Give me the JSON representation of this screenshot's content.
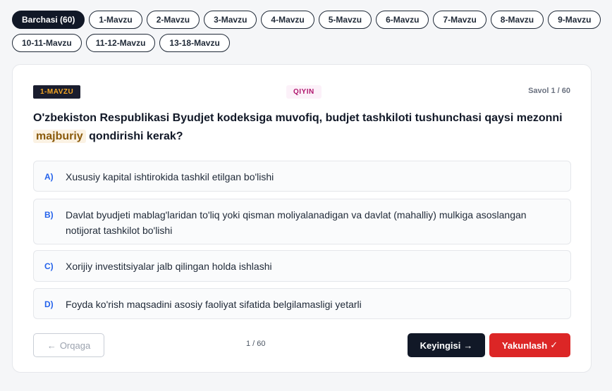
{
  "filters": {
    "chips": [
      {
        "label": "Barchasi (60)",
        "active": true
      },
      {
        "label": "1-Mavzu",
        "active": false
      },
      {
        "label": "2-Mavzu",
        "active": false
      },
      {
        "label": "3-Mavzu",
        "active": false
      },
      {
        "label": "4-Mavzu",
        "active": false
      },
      {
        "label": "5-Mavzu",
        "active": false
      },
      {
        "label": "6-Mavzu",
        "active": false
      },
      {
        "label": "7-Mavzu",
        "active": false
      },
      {
        "label": "8-Mavzu",
        "active": false
      },
      {
        "label": "9-Mavzu",
        "active": false
      },
      {
        "label": "10-11-Mavzu",
        "active": false
      },
      {
        "label": "11-12-Mavzu",
        "active": false
      },
      {
        "label": "13-18-Mavzu",
        "active": false
      }
    ]
  },
  "question_card": {
    "topic_badge": "1-MAVZU",
    "difficulty_badge": "QIYIN",
    "counter": "Savol 1 / 60",
    "question_before": "O'zbekiston Respublikasi Byudjet kodeksiga muvofiq, budjet tashkiloti tushunchasi qaysi mezonni",
    "question_highlight": "majburiy",
    "question_after": "qondirishi kerak?",
    "options": [
      {
        "letter": "A)",
        "text": "Xususiy kapital ishtirokida tashkil etilgan bo'lishi"
      },
      {
        "letter": "B)",
        "text": "Davlat byudjeti mablag'laridan to'liq yoki qisman moliyalanadigan va davlat (mahalliy) mulkiga asoslangan notijorat tashkilot bo'lishi"
      },
      {
        "letter": "C)",
        "text": "Xorijiy investitsiyalar jalb qilingan holda ishlashi"
      },
      {
        "letter": "D)",
        "text": "Foyda ko'rish maqsadini asosiy faoliyat sifatida belgilamasligi yetarli"
      }
    ]
  },
  "navigation": {
    "back_arrow": "←",
    "back_label": "Orqaga",
    "page_indicator": "1 / 60",
    "next_label": "Keyingisi",
    "next_arrow": "→",
    "finish_label": "Yakunlash",
    "finish_check": "✓"
  },
  "colors": {
    "accent_dark": "#111827",
    "finish_red": "#dc2626",
    "option_letter_blue": "#2563eb",
    "topic_badge_text": "#f5a623",
    "difficulty_text": "#b0156d"
  }
}
